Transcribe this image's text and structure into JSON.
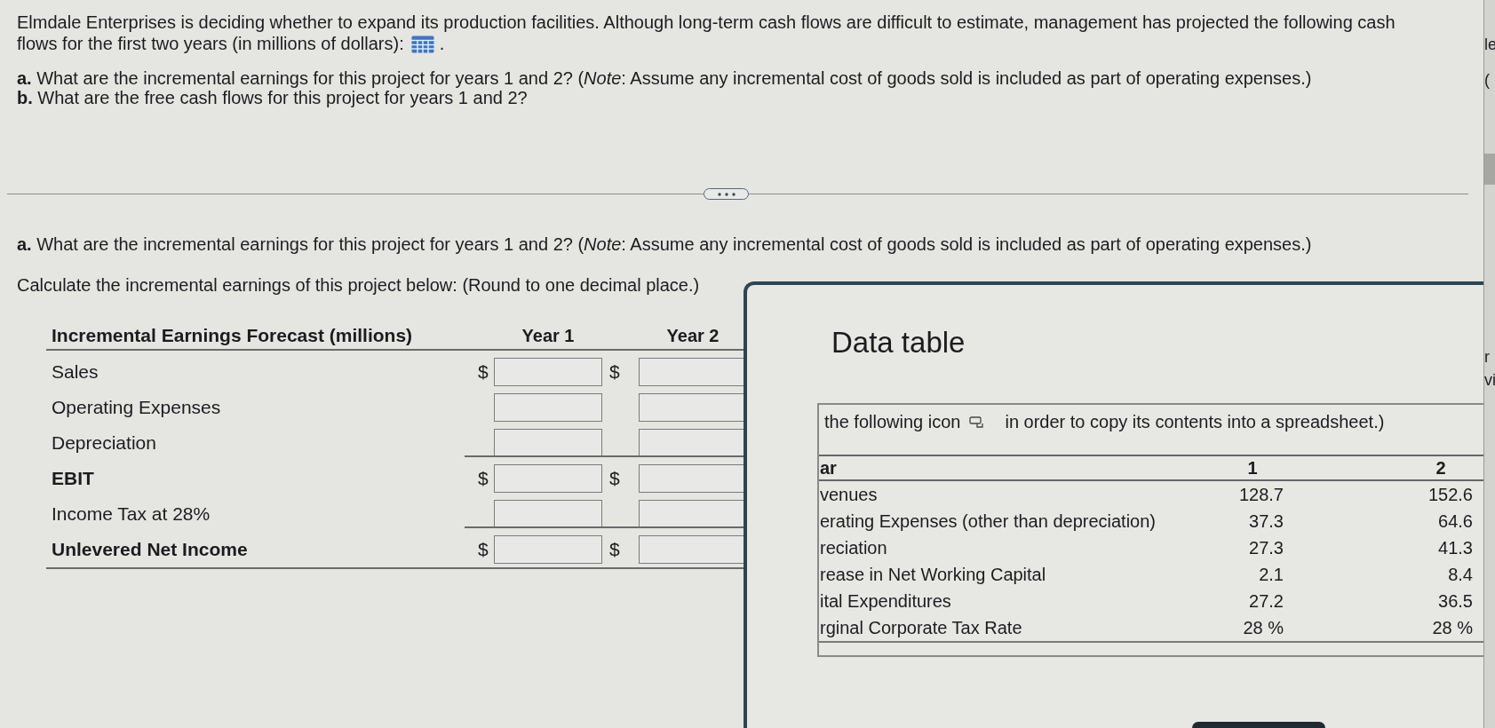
{
  "question": {
    "intro": "Elmdale Enterprises is deciding whether to expand its production facilities. Although long-term cash flows are difficult to estimate, management has projected the following cash flows for the first two years (in millions of dollars):",
    "after_icon": ".",
    "parts": [
      "**a.** What are the incremental earnings for this project for years 1 and 2? (*Note*: Assume any incremental cost of goods sold is included as part of operating expenses.)",
      "**b.** What are the free cash flows for this project for years 1 and 2?"
    ]
  },
  "part_a": {
    "question": "**a.** What are the incremental earnings for this project for years 1 and 2? (*Note*: Assume any incremental cost of goods sold is included as part of operating expenses.)",
    "instruction": "Calculate the incremental earnings of this project below: (Round to one decimal place.)",
    "table": {
      "columns": [
        "Incremental Earnings Forecast (millions)",
        "Year 1",
        "Year 2"
      ],
      "rows": [
        {
          "label": "Sales",
          "bold": false,
          "subtotal": false,
          "currency": [
            "$",
            "$"
          ]
        },
        {
          "label": "Operating Expenses",
          "bold": false,
          "subtotal": false
        },
        {
          "label": "Depreciation",
          "bold": false,
          "subtotal": false
        },
        {
          "label": "EBIT",
          "bold": true,
          "subtotal": true,
          "currency": [
            "$",
            "$"
          ]
        },
        {
          "label": "Income Tax at 28%",
          "bold": false,
          "subtotal": false
        },
        {
          "label": "Unlevered Net Income",
          "bold": true,
          "subtotal": true,
          "currency": [
            "$",
            "$"
          ]
        }
      ]
    }
  },
  "data_table": {
    "title": "Data table",
    "note_before": "the following icon",
    "note_after": "in order to copy its contents into a spreadsheet.)",
    "columns": [
      "ar",
      "1",
      "2"
    ],
    "rows": [
      [
        "venues",
        "128.7",
        "152.6"
      ],
      [
        "erating Expenses (other than depreciation)",
        "37.3",
        "64.6"
      ],
      [
        "reciation",
        "27.3",
        "41.3"
      ],
      [
        "rease in Net Working Capital",
        "2.1",
        "8.4"
      ],
      [
        "ital Expenditures",
        "27.2",
        "36.5"
      ],
      [
        "rginal Corporate Tax Rate",
        "28 %",
        "28 %"
      ]
    ]
  },
  "background_window": {
    "texts": [
      "le",
      "(",
      "r",
      "vi"
    ]
  }
}
